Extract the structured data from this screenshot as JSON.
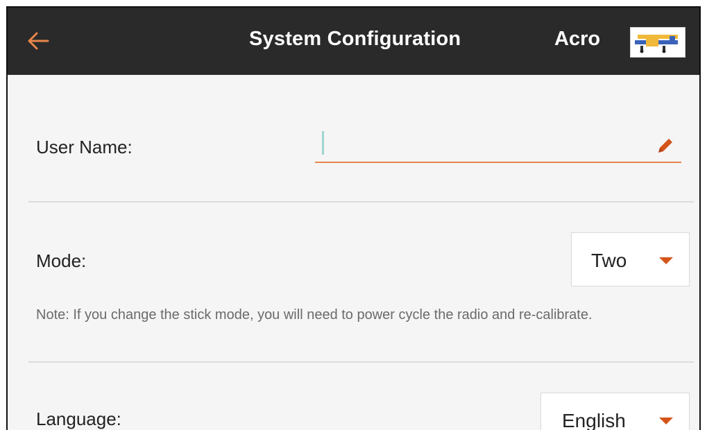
{
  "header": {
    "title": "System Configuration",
    "model_name": "Acro",
    "back_icon": "arrow-left-icon",
    "model_icon": "airplane-thumbnail-icon"
  },
  "user_name": {
    "label": "User Name:",
    "value": "",
    "edit_icon": "pencil-icon"
  },
  "mode": {
    "label": "Mode:",
    "selected": "Two",
    "note": "Note: If you change the stick mode, you will need to power cycle the radio and re-calibrate."
  },
  "language": {
    "label": "Language:",
    "selected": "English"
  },
  "colors": {
    "header_bg": "#2a2a2a",
    "accent": "#e8854a",
    "caret": "#d5541a",
    "page_bg": "#f5f5f5"
  }
}
